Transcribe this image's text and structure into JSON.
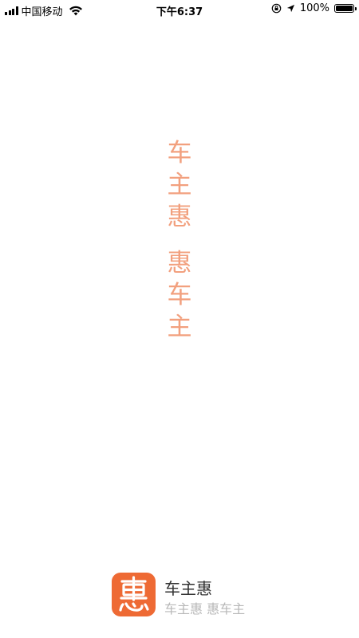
{
  "status_bar": {
    "carrier": "中国移动",
    "time": "下午6:37",
    "battery_percent": "100%",
    "battery_level": 1.0
  },
  "slogan": {
    "line1": [
      "车",
      "主",
      "惠"
    ],
    "line2": [
      "惠",
      "车",
      "主"
    ],
    "color": "#f2a07e"
  },
  "brand": {
    "logo_char": "惠",
    "logo_color": "#ee6a34",
    "name": "车主惠",
    "tagline": "车主惠 惠车主"
  }
}
